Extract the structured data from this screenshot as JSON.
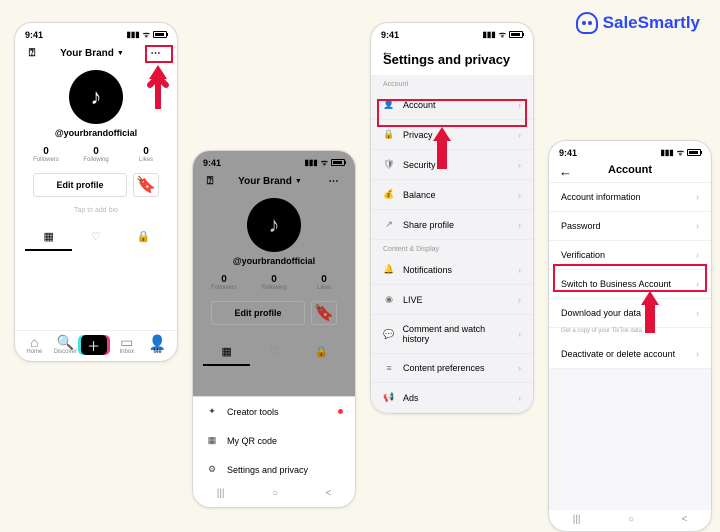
{
  "logo": "SaleSmartly",
  "time": "9:41",
  "profile": {
    "brand": "Your Brand",
    "handle": "@yourbrandofficial",
    "stats": [
      {
        "n": "0",
        "l": "Followers"
      },
      {
        "n": "0",
        "l": "Following"
      },
      {
        "n": "0",
        "l": "Likes"
      }
    ],
    "edit": "Edit profile",
    "tapbio": "Tap to add bio"
  },
  "nav": {
    "home": "Home",
    "discover": "Discover",
    "inbox": "Inbox",
    "me": "Me"
  },
  "sheet": {
    "creator": "Creator tools",
    "qr": "My QR code",
    "settings": "Settings and privacy"
  },
  "settings": {
    "title": "Settings and privacy",
    "h1": "Account",
    "account": "Account",
    "privacy": "Privacy",
    "security": "Security",
    "balance": "Balance",
    "share": "Share profile",
    "h2": "Content & Display",
    "notif": "Notifications",
    "live": "LIVE",
    "comment": "Comment and watch history",
    "pref": "Content preferences",
    "ads": "Ads"
  },
  "account": {
    "title": "Account",
    "info": "Account information",
    "pw": "Password",
    "verify": "Verification",
    "switch": "Switch to Business Account",
    "download": "Download your data",
    "dlsub": "Get a copy of your TikTok data",
    "deact": "Deactivate or delete account"
  }
}
